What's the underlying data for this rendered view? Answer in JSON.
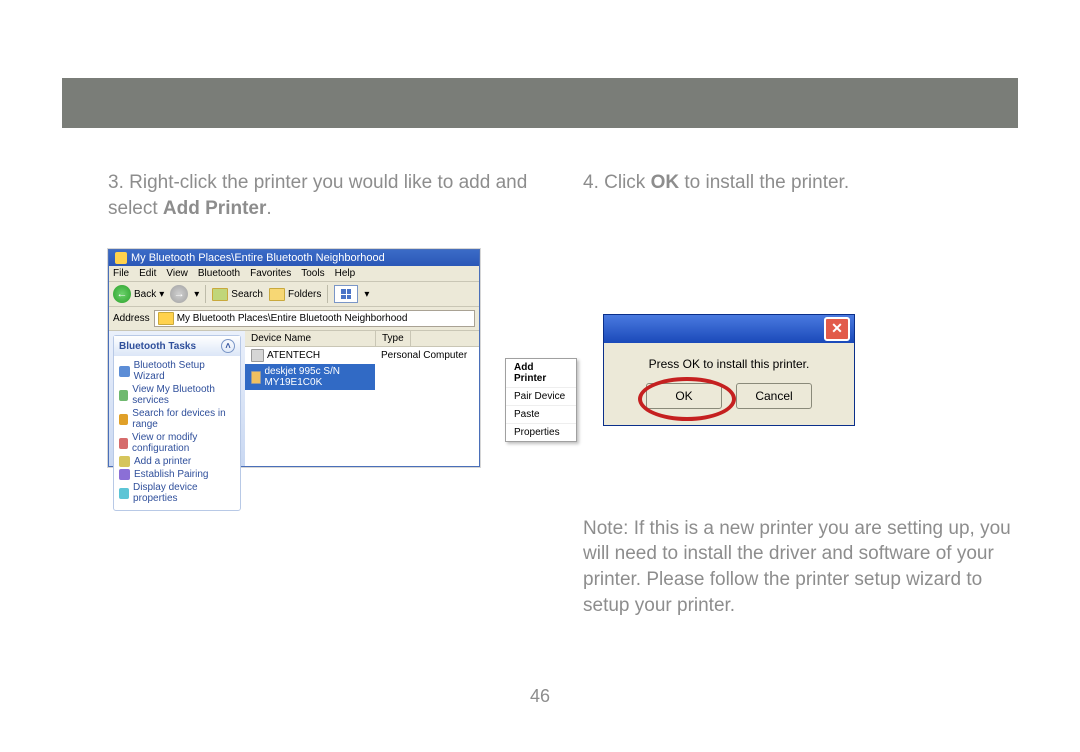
{
  "page_number": "46",
  "left": {
    "step_prefix": "3.  Right-click the printer you would like to add and select ",
    "step_bold": "Add Printer",
    "step_suffix": ".",
    "window_title": "My Bluetooth Places\\Entire Bluetooth Neighborhood",
    "menubar": [
      "File",
      "Edit",
      "View",
      "Bluetooth",
      "Favorites",
      "Tools",
      "Help"
    ],
    "toolbar": {
      "back": "Back",
      "search": "Search",
      "folders": "Folders"
    },
    "address_label": "Address",
    "address_value": "My Bluetooth Places\\Entire Bluetooth Neighborhood",
    "side_panel_title": "Bluetooth Tasks",
    "side_items": [
      "Bluetooth Setup Wizard",
      "View My Bluetooth services",
      "Search for devices in range",
      "View or modify configuration",
      "Add a printer",
      "Establish Pairing",
      "Display device properties"
    ],
    "col_device": "Device Name",
    "col_type": "Type",
    "row1_name": "ATENTECH",
    "row1_type": "Personal Computer",
    "row2_name": "deskjet 995c S/N MY19E1C0K",
    "ctx": [
      "Add Printer",
      "Pair Device",
      "Paste",
      "Properties"
    ]
  },
  "right": {
    "step_prefix": "4.  Click ",
    "step_bold": "OK",
    "step_suffix": " to install the printer.",
    "dlg_msg": "Press OK to install this printer.",
    "ok": "OK",
    "cancel": "Cancel",
    "note": "Note:  If this is a new printer you are setting up, you will need to install the driver and software of your printer. Please follow the printer setup wizard to setup your printer."
  }
}
